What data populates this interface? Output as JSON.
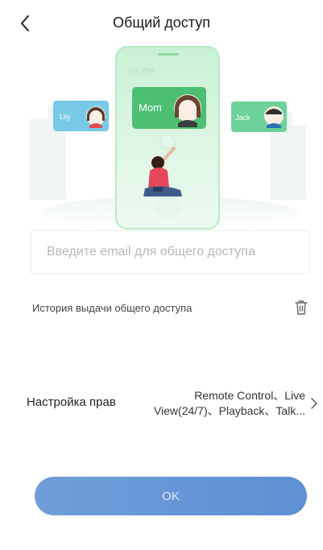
{
  "header": {
    "title": "Общий доступ"
  },
  "illustration": {
    "phone_label": "Live View",
    "cards": {
      "left": "Lily",
      "center": "Mom",
      "right": "Jack"
    }
  },
  "email": {
    "placeholder": "Введите email для общего доступа",
    "value": ""
  },
  "history": {
    "label": "История выдачи общего доступа"
  },
  "permissions": {
    "label": "Настройка прав",
    "value_line1": "Remote Control、Live",
    "value_line2": "View(24/7)、Playback、Talk..."
  },
  "actions": {
    "ok_label": "OK"
  },
  "colors": {
    "accent": "#6f9ed9",
    "card_green": "#5cc67f",
    "card_blue": "#6fc4e0"
  },
  "icons": {
    "back": "chevron-left-icon",
    "history": "trash-icon",
    "permissions": "chevron-right-icon"
  }
}
